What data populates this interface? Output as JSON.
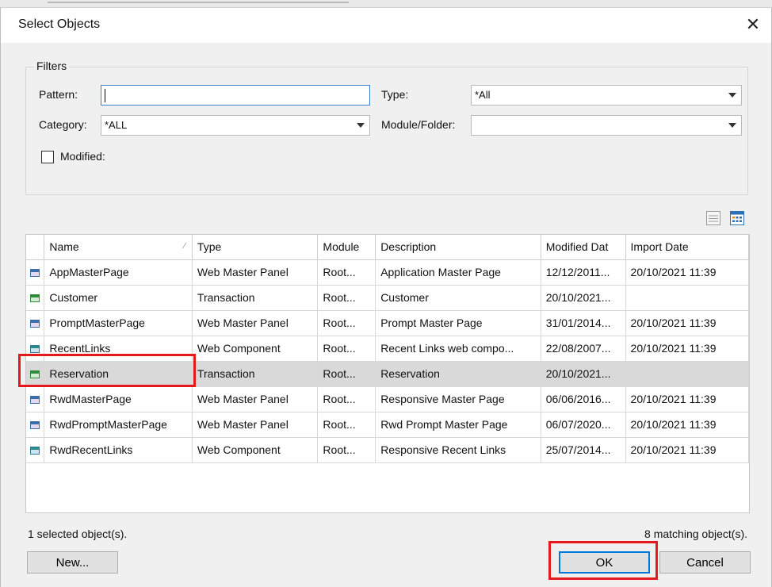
{
  "dialog": {
    "title": "Select Objects",
    "close_glyph": "✕"
  },
  "filters": {
    "legend": "Filters",
    "pattern": {
      "label": "Pattern:",
      "value": "",
      "placeholder": ""
    },
    "type": {
      "label": "Type:",
      "value": "*All"
    },
    "category": {
      "label": "Category:",
      "value": "*ALL"
    },
    "module_folder": {
      "label": "Module/Folder:",
      "value": ""
    },
    "modified": {
      "label": "Modified:",
      "checked": false
    }
  },
  "view_icons": [
    "list-view-icon",
    "details-view-icon"
  ],
  "grid": {
    "columns": [
      "",
      "Name",
      "Type",
      "Module",
      "Description",
      "Modified Dat",
      "Import Date"
    ],
    "sorted_column": "Name",
    "rows": [
      {
        "icon": "web-master-panel-icon",
        "name": "AppMasterPage",
        "type": "Web Master Panel",
        "module": "Root...",
        "description": "Application Master Page",
        "modified": "12/12/2011...",
        "import": "20/10/2021 11:39"
      },
      {
        "icon": "transaction-icon",
        "name": "Customer",
        "type": "Transaction",
        "module": "Root...",
        "description": "Customer",
        "modified": "20/10/2021...",
        "import": ""
      },
      {
        "icon": "web-master-panel-icon",
        "name": "PromptMasterPage",
        "type": "Web Master Panel",
        "module": "Root...",
        "description": "Prompt Master Page",
        "modified": "31/01/2014...",
        "import": "20/10/2021 11:39"
      },
      {
        "icon": "web-component-icon",
        "name": "RecentLinks",
        "type": "Web Component",
        "module": "Root...",
        "description": "Recent Links web compo...",
        "modified": "22/08/2007...",
        "import": "20/10/2021 11:39"
      },
      {
        "icon": "transaction-icon",
        "name": "Reservation",
        "type": "Transaction",
        "module": "Root...",
        "description": "Reservation",
        "modified": "20/10/2021...",
        "import": "",
        "selected": true
      },
      {
        "icon": "web-master-panel-icon",
        "name": "RwdMasterPage",
        "type": "Web Master Panel",
        "module": "Root...",
        "description": "Responsive Master Page",
        "modified": "06/06/2016...",
        "import": "20/10/2021 11:39"
      },
      {
        "icon": "web-master-panel-icon",
        "name": "RwdPromptMasterPage",
        "type": "Web Master Panel",
        "module": "Root...",
        "description": "Rwd Prompt Master Page",
        "modified": "06/07/2020...",
        "import": "20/10/2021 11:39"
      },
      {
        "icon": "web-component-icon",
        "name": "RwdRecentLinks",
        "type": "Web Component",
        "module": "Root...",
        "description": "Responsive Recent Links",
        "modified": "25/07/2014...",
        "import": "20/10/2021 11:39"
      }
    ]
  },
  "status": {
    "selected": "1 selected object(s).",
    "matching": "8 matching object(s)."
  },
  "buttons": {
    "new": "New...",
    "ok": "OK",
    "cancel": "Cancel"
  },
  "colors": {
    "highlight": "#e5191b",
    "focus_border": "#3c7fd6",
    "selected_row": "#d9d9d9"
  }
}
